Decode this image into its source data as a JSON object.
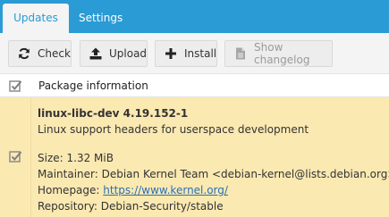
{
  "tabs": [
    {
      "label": "Updates",
      "active": true
    },
    {
      "label": "Settings",
      "active": false
    }
  ],
  "toolbar": {
    "check_label": "Check",
    "upload_label": "Upload",
    "install_label": "Install",
    "changelog_label": "Show changelog"
  },
  "table": {
    "header_label": "Package information",
    "rows": [
      {
        "name": "linux-libc-dev 4.19.152-1",
        "description": "Linux support headers for userspace development",
        "size": "Size: 1.32 MiB",
        "maintainer": "Maintainer: Debian Kernel Team <debian-kernel@lists.debian.org>",
        "homepage_prefix": "Homepage: ",
        "homepage_url": "https://www.kernel.org/",
        "repository": "Repository: Debian-Security/stable",
        "checked": true
      }
    ]
  },
  "colors": {
    "accent": "#2a9bd5",
    "selected_row": "#fbe9b2",
    "link": "#2a6fb5"
  }
}
